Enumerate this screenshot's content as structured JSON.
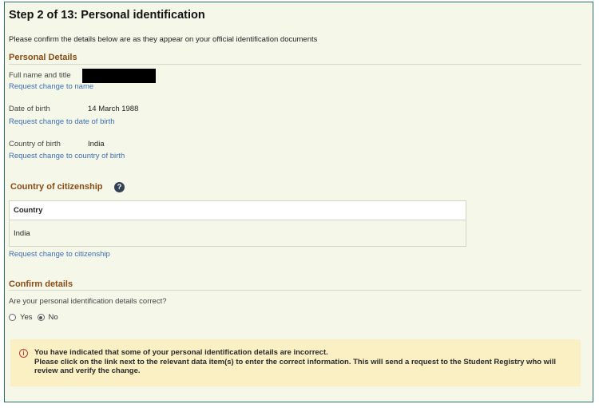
{
  "step_title": "Step 2 of 13: Personal identification",
  "intro_text": "Please confirm the details below are as they appear on your official identification documents",
  "personal_details": {
    "heading": "Personal Details",
    "full_name": {
      "label": "Full name and title",
      "link": "Request change to name"
    },
    "date_of_birth": {
      "label": "Date of birth",
      "value": "14 March 1988",
      "link": "Request change to date of birth"
    },
    "country_of_birth": {
      "label": "Country of birth",
      "value": "India",
      "link": "Request change to country of birth"
    }
  },
  "citizenship": {
    "heading": "Country of citizenship",
    "help_icon": "question-circle-icon",
    "table": {
      "column_header": "Country",
      "rows": [
        "India"
      ]
    },
    "link": "Request change to citizenship"
  },
  "confirm": {
    "heading": "Confirm details",
    "question": "Are your personal identification details correct?",
    "options": [
      {
        "label": "Yes",
        "selected": false
      },
      {
        "label": "No",
        "selected": true
      }
    ]
  },
  "alert": {
    "icon": "info-circle-icon",
    "line1": "You have indicated that some of your personal identification details are incorrect.",
    "line2": "Please click on the link next to the relevant data item(s) to enter the correct information. This will send a request to the Student Registry who will",
    "line3": "review and verify the change."
  },
  "colors": {
    "frame_border": "#2f6d6a",
    "background": "#f5f7e8",
    "heading": "#8a4b14",
    "link": "#3c6fb4",
    "alert_bg": "#fbefc4",
    "alert_icon": "#b53c3c"
  }
}
